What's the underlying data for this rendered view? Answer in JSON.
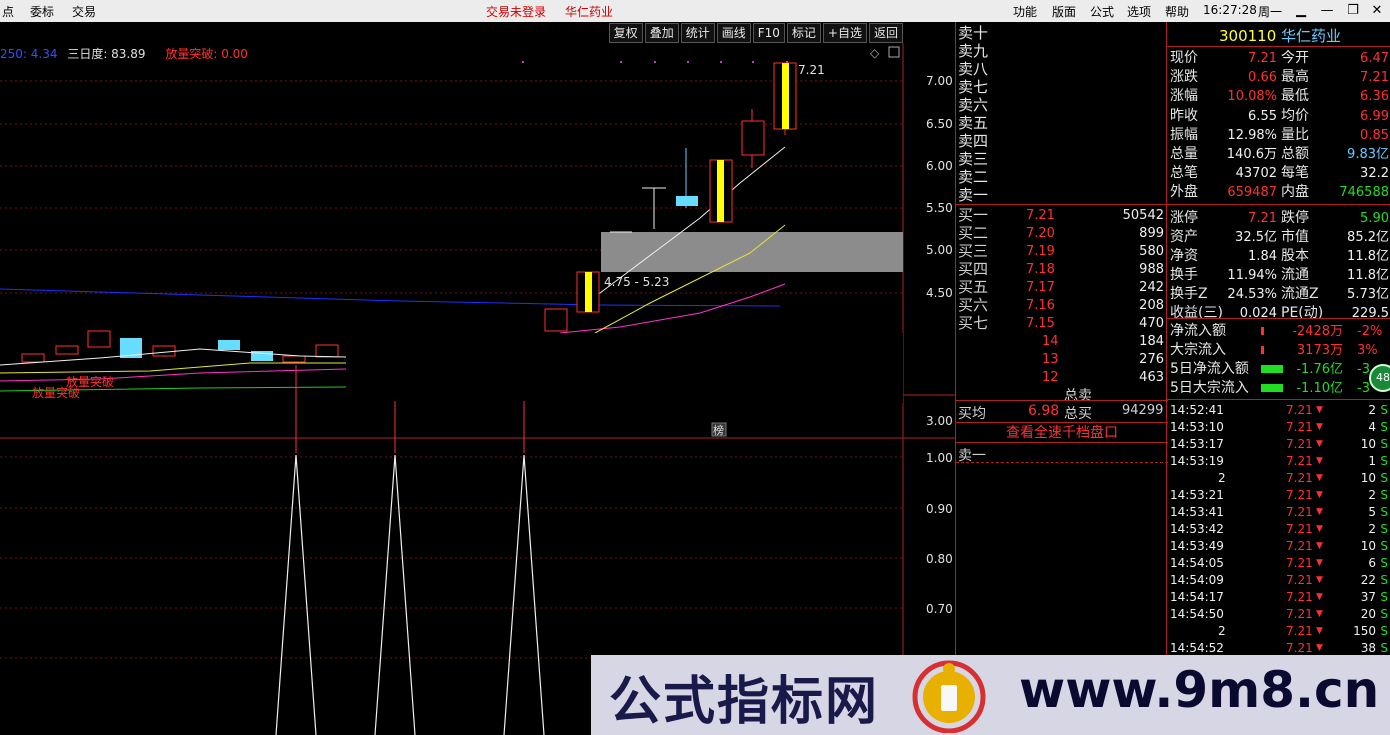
{
  "menu": {
    "left": [
      "点",
      "委标",
      "交易"
    ],
    "status": "交易未登录",
    "stock": "华仁药业",
    "right": [
      "功能",
      "版面",
      "公式",
      "选项",
      "帮助"
    ],
    "time": "16:27:28",
    "weekday": "周一"
  },
  "toolbar": [
    "复权",
    "叠加",
    "统计",
    "画线",
    "F10",
    "标记",
    "+自选",
    "返回"
  ],
  "indicators": {
    "ma_label": "250: 4.34",
    "three_day": "三日度: 83.89",
    "breakout": "放量突破: 0.00"
  },
  "price_axis": [
    "7.00",
    "6.50",
    "6.00",
    "5.50",
    "5.00",
    "4.50",
    "3.00",
    "1.00",
    "0.90",
    "0.80",
    "0.70"
  ],
  "chart_labels": {
    "high": "7.21",
    "range": "4.75 - 5.23",
    "breakout1": "放量突破",
    "breakout2": "放量突破",
    "marker": "榜"
  },
  "orderbook": {
    "sell": [
      "卖十",
      "卖九",
      "卖八",
      "卖七",
      "卖六",
      "卖五",
      "卖四",
      "卖三",
      "卖二",
      "卖一"
    ],
    "buy": [
      {
        "label": "买一",
        "price": "7.21",
        "vol": "50542"
      },
      {
        "label": "买二",
        "price": "7.20",
        "vol": "899"
      },
      {
        "label": "买三",
        "price": "7.19",
        "vol": "580"
      },
      {
        "label": "买四",
        "price": "7.18",
        "vol": "988"
      },
      {
        "label": "买五",
        "price": "7.17",
        "vol": "242"
      },
      {
        "label": "买六",
        "price": "7.16",
        "vol": "208"
      },
      {
        "label": "买七",
        "price": "7.15",
        "vol": "470"
      },
      {
        "label": "",
        "price": "14",
        "vol": "184"
      },
      {
        "label": "",
        "price": "13",
        "vol": "276"
      },
      {
        "label": "",
        "price": "12",
        "vol": "463"
      }
    ],
    "total_sell": "总卖",
    "avg_buy_label": "买均",
    "avg_buy": "6.98",
    "total_buy_label": "总买",
    "total_buy": "94299",
    "full_depth": "查看全速千档盘口",
    "sell1_bottom": "卖一"
  },
  "quote": {
    "code": "300110",
    "name": "华仁药业",
    "rows": [
      {
        "l1": "现价",
        "v1": "7.21",
        "c1": "red",
        "l2": "今开",
        "v2": "6.47",
        "c2": "red"
      },
      {
        "l1": "涨跌",
        "v1": "0.66",
        "c1": "red",
        "l2": "最高",
        "v2": "7.21",
        "c2": "red"
      },
      {
        "l1": "涨幅",
        "v1": "10.08%",
        "c1": "red",
        "l2": "最低",
        "v2": "6.36",
        "c2": "red"
      },
      {
        "l1": "昨收",
        "v1": "6.55",
        "c1": "wht",
        "l2": "均价",
        "v2": "6.99",
        "c2": "red"
      },
      {
        "l1": "振幅",
        "v1": "12.98%",
        "c1": "wht",
        "l2": "量比",
        "v2": "0.85",
        "c2": "red"
      },
      {
        "l1": "总量",
        "v1": "140.6万",
        "c1": "wht",
        "l2": "总额",
        "v2": "9.83亿",
        "c2": "cyan"
      },
      {
        "l1": "总笔",
        "v1": "43702",
        "c1": "wht",
        "l2": "每笔",
        "v2": "32.2",
        "c2": "wht"
      },
      {
        "l1": "外盘",
        "v1": "659487",
        "c1": "red",
        "l2": "内盘",
        "v2": "746588",
        "c2": "grn"
      },
      {
        "l1": "涨停",
        "v1": "7.21",
        "c1": "red",
        "l2": "跌停",
        "v2": "5.90",
        "c2": "grn"
      },
      {
        "l1": "资产",
        "v1": "32.5亿",
        "c1": "wht",
        "l2": "市值",
        "v2": "85.2亿",
        "c2": "wht"
      },
      {
        "l1": "净资",
        "v1": "1.84",
        "c1": "wht",
        "l2": "股本",
        "v2": "11.8亿",
        "c2": "wht"
      },
      {
        "l1": "换手",
        "v1": "11.94%",
        "c1": "wht",
        "l2": "流通",
        "v2": "11.8亿",
        "c2": "wht"
      },
      {
        "l1": "换手Z",
        "v1": "24.53%",
        "c1": "wht",
        "l2": "流通Z",
        "v2": "5.73亿",
        "c2": "wht"
      },
      {
        "l1": "收益(三)",
        "v1": "0.024",
        "c1": "wht",
        "l2": "PE(动)",
        "v2": "229.5",
        "c2": "wht"
      }
    ],
    "flows": [
      {
        "label": "净流入额",
        "value": "-2428万",
        "pct": "-2%",
        "color": "red"
      },
      {
        "label": "大宗流入",
        "value": "3173万",
        "pct": "3%",
        "color": "red"
      },
      {
        "label": "5日净流入额",
        "value": "-1.76亿",
        "pct": "-3",
        "color": "grn"
      },
      {
        "label": "5日大宗流入",
        "value": "-1.10亿",
        "pct": "-3",
        "color": "grn"
      }
    ],
    "badge": "48"
  },
  "ticks": [
    {
      "time": "14:52:41",
      "price": "7.21",
      "vol": "2",
      "side": "S"
    },
    {
      "time": "14:53:10",
      "price": "7.21",
      "vol": "4",
      "side": "S"
    },
    {
      "time": "14:53:17",
      "price": "7.21",
      "vol": "10",
      "side": "S"
    },
    {
      "time": "14:53:19",
      "price": "7.21",
      "vol": "1",
      "side": "S"
    },
    {
      "time": "2",
      "price": "7.21",
      "vol": "10",
      "side": "S"
    },
    {
      "time": "14:53:21",
      "price": "7.21",
      "vol": "2",
      "side": "S"
    },
    {
      "time": "14:53:41",
      "price": "7.21",
      "vol": "5",
      "side": "S"
    },
    {
      "time": "14:53:42",
      "price": "7.21",
      "vol": "2",
      "side": "S"
    },
    {
      "time": "14:53:49",
      "price": "7.21",
      "vol": "10",
      "side": "S"
    },
    {
      "time": "14:54:05",
      "price": "7.21",
      "vol": "6",
      "side": "S"
    },
    {
      "time": "14:54:09",
      "price": "7.21",
      "vol": "22",
      "side": "S"
    },
    {
      "time": "14:54:17",
      "price": "7.21",
      "vol": "37",
      "side": "S"
    },
    {
      "time": "14:54:50",
      "price": "7.21",
      "vol": "20",
      "side": "S"
    },
    {
      "time": "2",
      "price": "7.21",
      "vol": "150",
      "side": "S"
    },
    {
      "time": "14:54:52",
      "price": "7.21",
      "vol": "38",
      "side": "S"
    }
  ],
  "banner": {
    "text": "公式指标网",
    "url": "www.9m8.cn"
  }
}
